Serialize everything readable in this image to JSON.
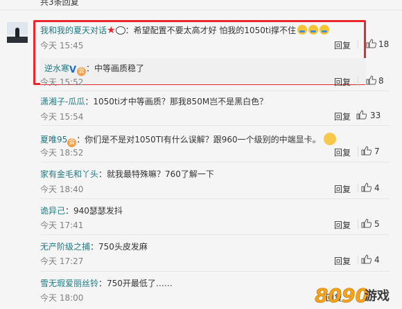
{
  "header": {
    "text": "共3条回复"
  },
  "main_comment": {
    "user": "我和我的夏天对话",
    "text": "：希望配置不要太高才好 怕我的1050ti撑不住",
    "time": "今天 15:45",
    "reply_label": "回复",
    "likes": "18"
  },
  "sub_reply": {
    "user": "逆水寒",
    "text": "：中等画质稳了",
    "time": "今天 15:52",
    "reply_label": "回复",
    "likes": "8"
  },
  "comments": [
    {
      "user": "潇湘子-瓜瓜",
      "text": "：1050ti才中等画质？那我850M岂不是黑白色？",
      "time": "今天 15:54",
      "reply_label": "回复",
      "likes": "33"
    },
    {
      "user": "夏唯95",
      "text": "：你们是不是对1050TI有什么误解？跟960一个级别的中端显卡。",
      "time": "今天 18:52",
      "reply_label": "回复",
      "likes": "7"
    },
    {
      "user": "家有金毛和丫头",
      "text": "：就我最特殊嘛？760了解一下",
      "time": "今天 18:40",
      "reply_label": "回复",
      "likes": "4"
    },
    {
      "user": "诡异己",
      "text": "：940瑟瑟发抖",
      "time": "今天 17:41",
      "reply_label": "回复",
      "likes": "5"
    },
    {
      "user": "无产阶级之捕",
      "text": "：750头皮发麻",
      "time": "今天 17:27",
      "reply_label": "回复",
      "likes": "4"
    },
    {
      "user": "雪无瑕爱丽丝铃",
      "text": "：750开最低了……",
      "time": "今天 18:00",
      "reply_label": "回复",
      "likes": ""
    }
  ],
  "watermark": {
    "number": "8090",
    "text": "游戏"
  },
  "colors": {
    "highlight_border": "#e8262b",
    "username": "#1e7a83",
    "username_main": "#eb7350",
    "time": "#808080"
  }
}
